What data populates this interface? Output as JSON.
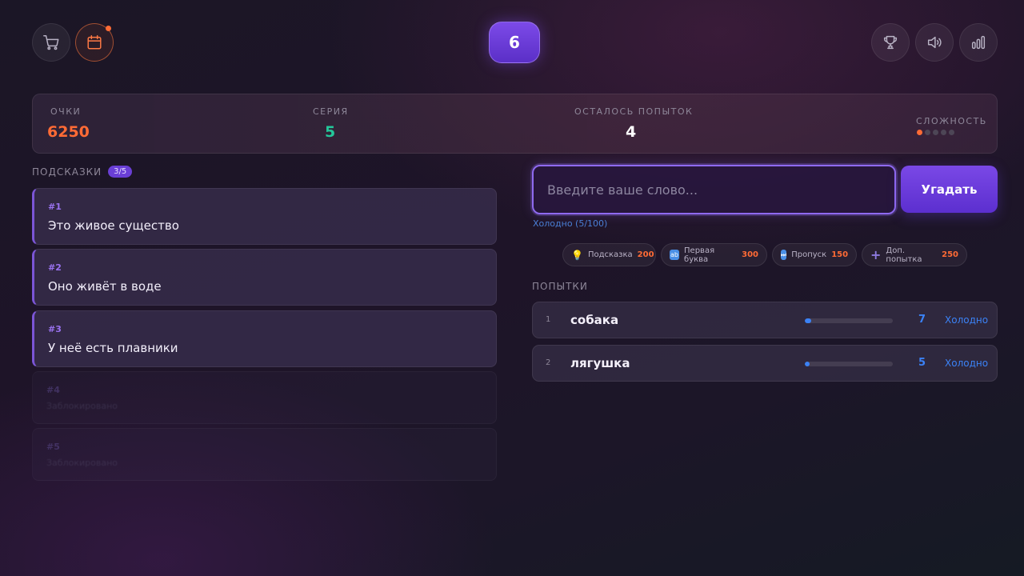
{
  "header": {
    "level": "6",
    "left_icons": [
      "cart-icon",
      "calendar-icon"
    ],
    "right_icons": [
      "trophy-icon",
      "sound-icon",
      "stats-icon"
    ]
  },
  "stats": {
    "score_label": "ОЧКИ",
    "score_value": "6250",
    "streak_label": "СЕРИЯ",
    "streak_value": "5",
    "attempts_label": "ОСТАЛОСЬ ПОПЫТОК",
    "attempts_value": "4",
    "difficulty_label": "СЛОЖНОСТЬ",
    "difficulty_level": 1,
    "difficulty_max": 5
  },
  "hints": {
    "title": "ПОДСКАЗКИ",
    "counter": "3/5",
    "items": [
      {
        "num": "#1",
        "text": "Это живое существо",
        "locked": false
      },
      {
        "num": "#2",
        "text": "Оно живёт в воде",
        "locked": false
      },
      {
        "num": "#3",
        "text": "У неё есть плавники",
        "locked": false
      },
      {
        "num": "#4",
        "text": "Заблокировано",
        "locked": true
      },
      {
        "num": "#5",
        "text": "Заблокировано",
        "locked": true
      }
    ]
  },
  "guess": {
    "placeholder": "Введите ваше слово...",
    "value": "",
    "button_label": "Угадать",
    "temperature_note": "Холодно (5/100)"
  },
  "powerups": [
    {
      "icon": "lightbulb-icon",
      "label": "Подсказка",
      "cost": "200"
    },
    {
      "icon": "first-letter-icon",
      "label": "Первая буква",
      "cost": "300"
    },
    {
      "icon": "skip-icon",
      "label": "Пропуск",
      "cost": "150"
    },
    {
      "icon": "plus-icon",
      "label": "Доп. попытка",
      "cost": "250"
    }
  ],
  "attempts": {
    "title": "ПОПЫТКИ",
    "items": [
      {
        "index": "1",
        "word": "собака",
        "score": "7",
        "progress": 0.07,
        "temperature": "Холодно"
      },
      {
        "index": "2",
        "word": "лягушка",
        "score": "5",
        "progress": 0.05,
        "temperature": "Холодно"
      }
    ]
  },
  "colors": {
    "accent_purple": "#7a48e6",
    "score_orange": "#ff6b35",
    "streak_green": "#24c79a",
    "cold_blue": "#3b82f6"
  }
}
